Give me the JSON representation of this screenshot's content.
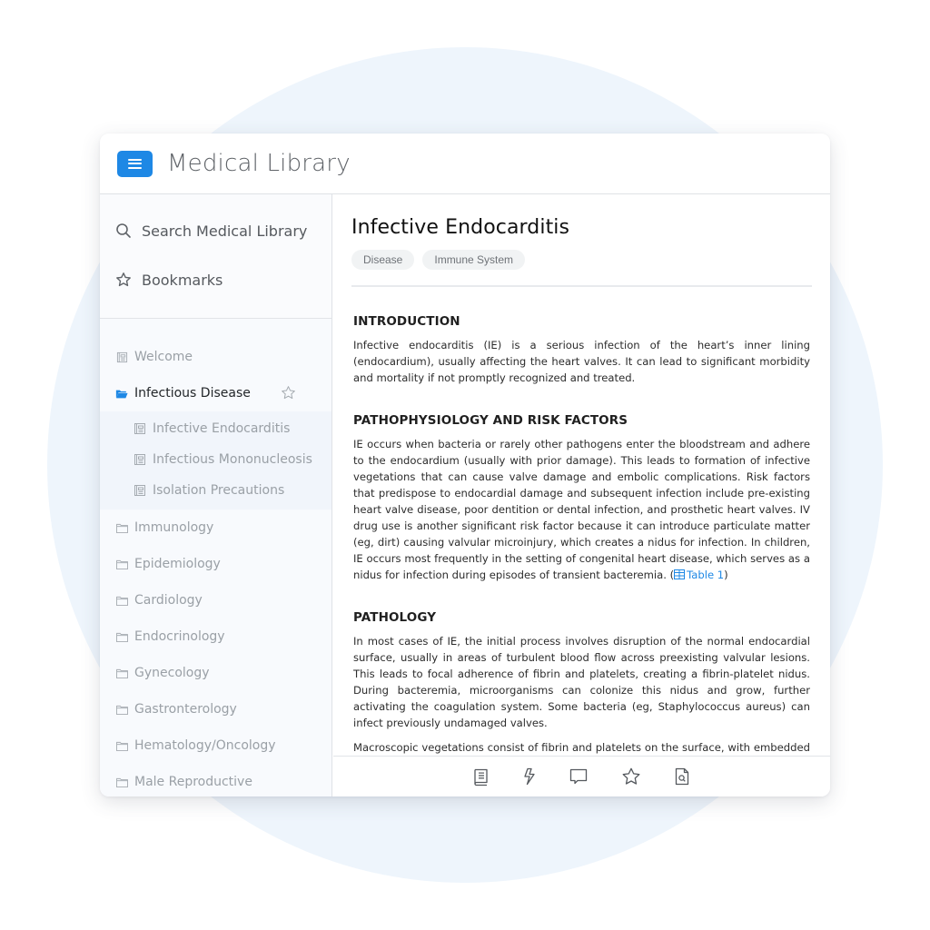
{
  "app": {
    "title": "Medical Library",
    "accent_color": "#1e88e5"
  },
  "sidebar": {
    "actions": [
      {
        "icon": "search-icon",
        "label": "Search Medical Library"
      },
      {
        "icon": "star-icon",
        "label": "Bookmarks"
      }
    ],
    "tree": {
      "welcome": {
        "icon": "article-icon",
        "label": "Welcome"
      },
      "active_folder": {
        "icon": "folder-open-icon",
        "label": "Infectious Disease",
        "bookmark_icon": "star-outline-icon"
      },
      "active_children": [
        {
          "icon": "article-icon",
          "label": "Infective Endocarditis"
        },
        {
          "icon": "article-icon",
          "label": "Infectious Mononucleosis"
        },
        {
          "icon": "article-icon",
          "label": "Isolation Precautions"
        }
      ],
      "folders": [
        {
          "icon": "folder-icon",
          "label": "Immunology"
        },
        {
          "icon": "folder-icon",
          "label": "Epidemiology"
        },
        {
          "icon": "folder-icon",
          "label": "Cardiology"
        },
        {
          "icon": "folder-icon",
          "label": "Endocrinology"
        },
        {
          "icon": "folder-icon",
          "label": "Gynecology"
        },
        {
          "icon": "folder-icon",
          "label": "Gastronterology"
        },
        {
          "icon": "folder-icon",
          "label": "Hematology/Oncology"
        },
        {
          "icon": "folder-icon",
          "label": "Male Reproductive"
        }
      ]
    }
  },
  "article": {
    "title": "Infective Endocarditis",
    "tags": [
      "Disease",
      "Immune System"
    ],
    "sections": {
      "intro": {
        "heading": "INTRODUCTION",
        "text": "Infective endocarditis (IE) is a serious infection of the heart’s inner lining (endocardium), usually affecting the heart valves. It can lead to significant morbidity and mortality if not promptly recognized and treated."
      },
      "patho": {
        "heading": "PATHOPHYSIOLOGY AND RISK FACTORS",
        "text": "IE occurs when bacteria or rarely other pathogens enter the bloodstream and adhere to the endocardium (usually with prior damage). This leads to formation of infective vegetations that can cause valve damage and embolic complications. Risk factors that predispose to endocardial damage and subsequent infection include pre-existing heart valve disease, poor dentition or dental infection, and prosthetic heart valves. IV drug use is another significant risk factor because it can introduce particulate matter (eg, dirt) causing valvular microinjury, which creates a nidus for infection. In children, IE occurs most frequently in the setting of congenital heart disease, which serves as a nidus for infection during episodes of transient bacteremia. (",
        "link_icon": "table-icon",
        "link_label": "Table 1",
        "text_after": ")"
      },
      "pathology": {
        "heading": "PATHOLOGY",
        "paragraphs": [
          "In most cases of IE, the initial process involves disruption of the normal endocardial surface, usually in areas of turbulent blood flow across preexisting valvular lesions. This leads to focal adherence of fibrin and platelets, creating a fibrin-platelet nidus. During bacteremia, microorganisms can colonize this nidus and grow, further activating the coagulation system. Some bacteria (eg, Staphylococcus aureus) can infect previously undamaged valves.",
          "Macroscopic vegetations consist of fibrin and platelets on the surface, with embedded red blood cell debris, leukocytes, and clusters of microorganisms. These vegetations can lead to valve destruction, heart failure/conduction abnormalities, and embolic events. In addition, infection may extend into surrounding tissue."
        ]
      }
    }
  },
  "toolbar": {
    "buttons": [
      {
        "icon": "book-icon",
        "label": "Contents"
      },
      {
        "icon": "lightning-icon",
        "label": "Quick facts"
      },
      {
        "icon": "comment-icon",
        "label": "Comments"
      },
      {
        "icon": "star-icon",
        "label": "Bookmark"
      },
      {
        "icon": "document-search-icon",
        "label": "Find in article"
      }
    ]
  }
}
